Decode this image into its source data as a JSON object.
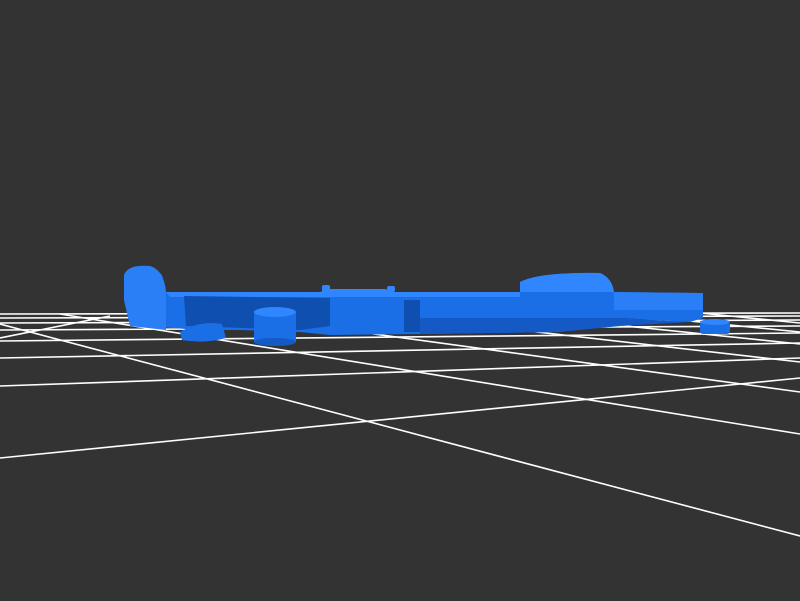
{
  "viewport": {
    "background_color": "#333333",
    "grid_color": "#ffffff",
    "model_color": "#1a6ee6",
    "model_highlight_color": "#2f86ff",
    "model_shadow_color": "#0f4fb0"
  }
}
